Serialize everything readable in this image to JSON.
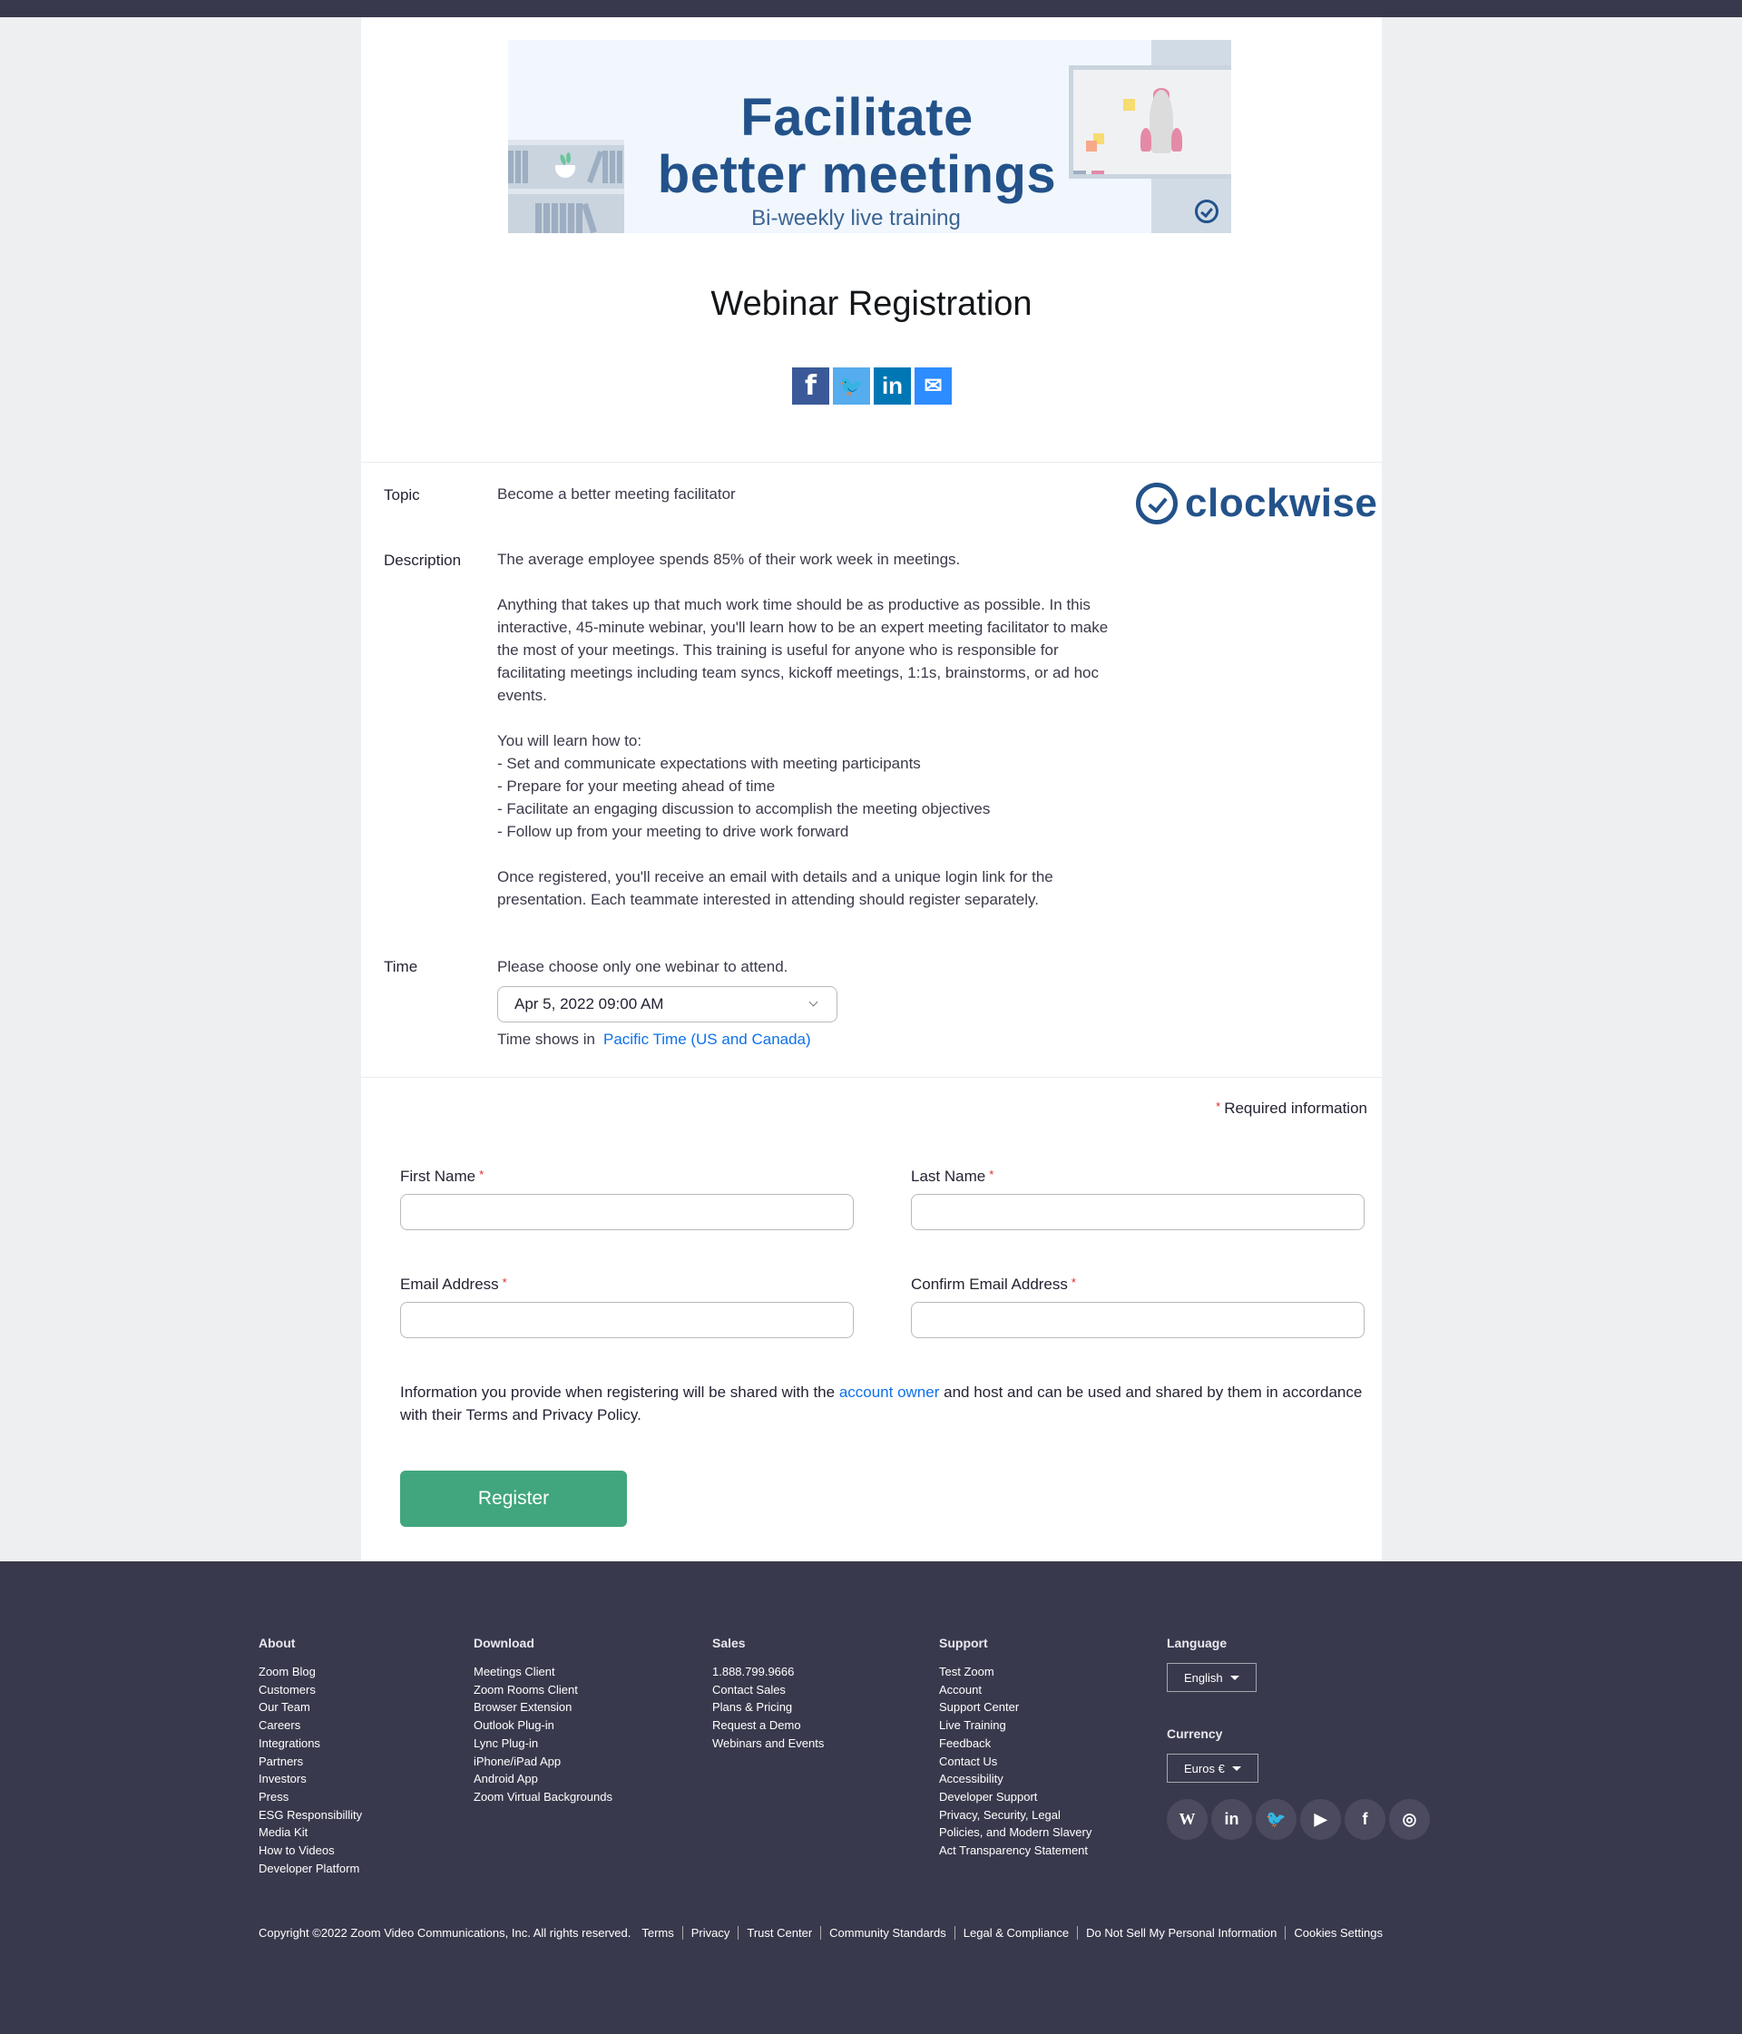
{
  "banner": {
    "line1": "Facilitate",
    "line2": "better meetings",
    "subtitle": "Bi-weekly live training"
  },
  "page_title": "Webinar Registration",
  "share": [
    {
      "icon": "facebook-icon",
      "glyph": "f",
      "color": "#3b5998"
    },
    {
      "icon": "twitter-icon",
      "glyph": "🐦",
      "color": "#55acee"
    },
    {
      "icon": "linkedin-icon",
      "glyph": "in",
      "color": "#0077b5"
    },
    {
      "icon": "email-icon",
      "glyph": "✉",
      "color": "#2d8cff"
    }
  ],
  "details": {
    "topic_label": "Topic",
    "topic": "Become a better meeting facilitator",
    "sponsor_logo_text": "clockwise",
    "description_label": "Description",
    "description": [
      "The average employee spends 85% of their work week in meetings.",
      "Anything that takes up that much work time should be as productive as possible. In this interactive, 45-minute webinar, you'll learn how to be an expert meeting facilitator to make the most of your meetings. This training is useful for anyone who is responsible for facilitating meetings including team syncs, kickoff meetings, 1:1s, brainstorms, or ad hoc events.",
      "You will learn how to:",
      "- Set and communicate expectations with meeting participants",
      "- Prepare for your meeting ahead of time",
      "- Facilitate an engaging discussion to accomplish the meeting objectives",
      "- Follow up from your meeting to drive work forward",
      "Once registered, you'll receive an email with details and a unique login link for the presentation. Each teammate interested in attending should register separately."
    ],
    "time_label": "Time",
    "time_hint": "Please choose only one webinar to attend.",
    "time_selected": "Apr 5, 2022 09:00 AM",
    "timezone_prefix": "Time shows in",
    "timezone": "Pacific Time (US and Canada)"
  },
  "form": {
    "required_note": "Required information",
    "first_name_label": "First Name",
    "first_name_value": "",
    "last_name_label": "Last Name",
    "last_name_value": "",
    "email_label": "Email Address",
    "email_value": "",
    "confirm_email_label": "Confirm Email Address",
    "confirm_email_value": "",
    "notice_before": "Information you provide when registering will be shared with the ",
    "notice_link": "account owner",
    "notice_after": " and host and can be used and shared by them in accordance with their Terms and Privacy Policy.",
    "register_label": "Register"
  },
  "colors": {
    "brand_blue": "#23528a",
    "register_green": "#41a67d",
    "link_blue": "#0e71eb",
    "footer_bg": "#39394d"
  },
  "footer": {
    "columns": [
      {
        "title": "About",
        "links": [
          "Zoom Blog",
          "Customers",
          "Our Team",
          "Careers",
          "Integrations",
          "Partners",
          "Investors",
          "Press",
          "ESG Responsibillity",
          "Media Kit",
          "How to Videos",
          "Developer Platform"
        ]
      },
      {
        "title": "Download",
        "links": [
          "Meetings Client",
          "Zoom Rooms Client",
          "Browser Extension",
          "Outlook Plug-in",
          "Lync Plug-in",
          "iPhone/iPad App",
          "Android App",
          "Zoom Virtual Backgrounds"
        ]
      },
      {
        "title": "Sales",
        "links": [
          "1.888.799.9666",
          "Contact Sales",
          "Plans & Pricing",
          "Request a Demo",
          "Webinars and Events"
        ]
      },
      {
        "title": "Support",
        "links": [
          "Test Zoom",
          "Account",
          "Support Center",
          "Live Training",
          "Feedback",
          "Contact Us",
          "Accessibility",
          "Developer Support",
          "Privacy, Security, Legal",
          "Policies, and Modern Slavery",
          "Act Transparency Statement"
        ]
      }
    ],
    "language_title": "Language",
    "language_value": "English",
    "currency_title": "Currency",
    "currency_value": "Euros €",
    "social": [
      {
        "icon": "wordpress-icon",
        "glyph": "W"
      },
      {
        "icon": "linkedin-icon",
        "glyph": "in"
      },
      {
        "icon": "twitter-icon",
        "glyph": "🐦"
      },
      {
        "icon": "youtube-icon",
        "glyph": "▶"
      },
      {
        "icon": "facebook-icon",
        "glyph": "f"
      },
      {
        "icon": "instagram-icon",
        "glyph": "◎"
      }
    ],
    "copyright": "Copyright ©2022 Zoom Video Communications, Inc. All rights reserved.",
    "legal_links": [
      "Terms",
      "Privacy",
      "Trust Center",
      "Community Standards",
      "Legal & Compliance",
      "Do Not Sell My Personal Information",
      "Cookies Settings"
    ]
  }
}
